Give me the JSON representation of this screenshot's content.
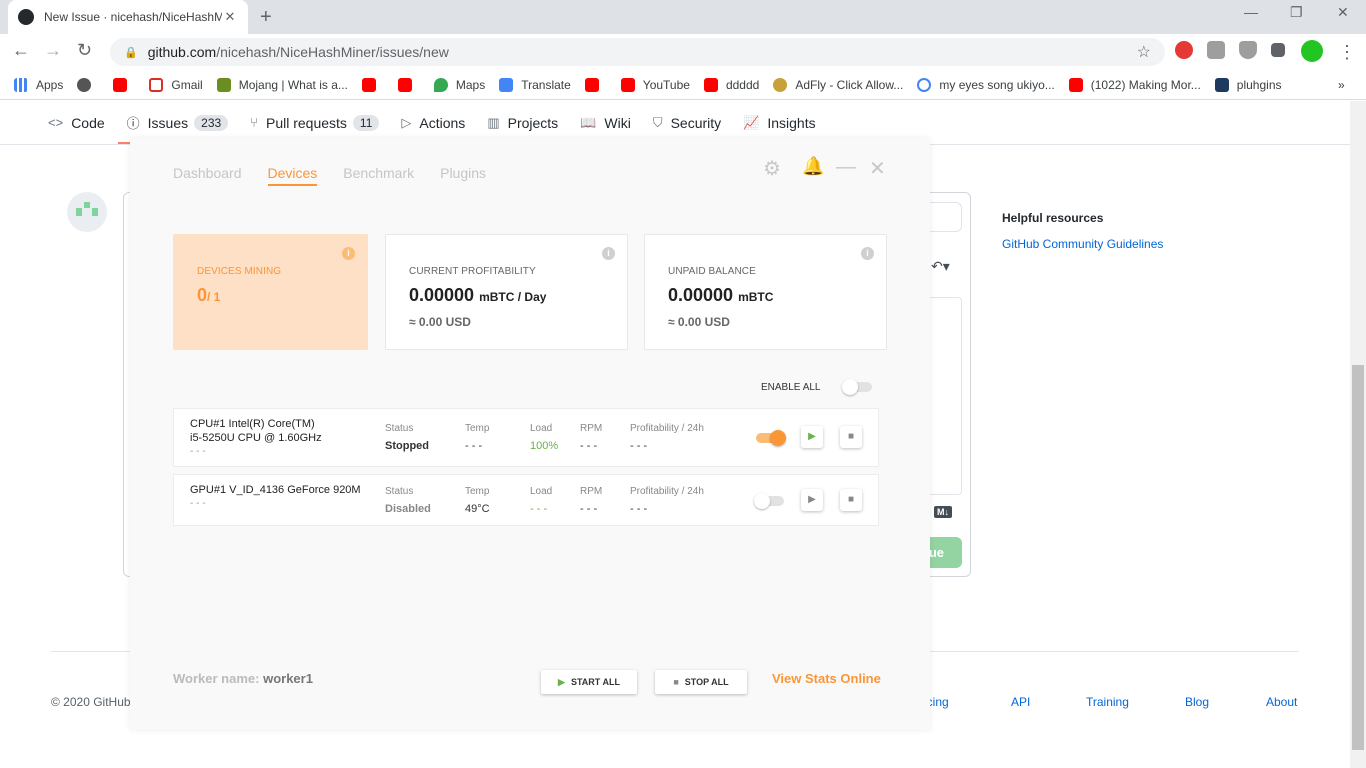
{
  "browser": {
    "tab_title": "New Issue · nicehash/NiceHashM",
    "url_host": "github.com",
    "url_path": "/nicehash/NiceHashMiner/issues/new",
    "bookmarks": [
      "Apps",
      "",
      "",
      "Gmail",
      "Mojang | What is a...",
      "",
      "",
      "Maps",
      "Translate",
      "",
      "YouTube",
      "ddddd",
      "AdFly - Click Allow...",
      "my eyes song ukiyo...",
      "(1022) Making Mor...",
      "pluhgins"
    ]
  },
  "github": {
    "nav": [
      {
        "label": "Code",
        "icon": "code-icon"
      },
      {
        "label": "Issues",
        "count": "233",
        "icon": "issue-icon"
      },
      {
        "label": "Pull requests",
        "count": "11",
        "icon": "pull-request-icon"
      },
      {
        "label": "Actions",
        "icon": "play-circle-icon"
      },
      {
        "label": "Projects",
        "icon": "project-icon"
      },
      {
        "label": "Wiki",
        "icon": "book-icon"
      },
      {
        "label": "Security",
        "icon": "shield-icon"
      },
      {
        "label": "Insights",
        "icon": "graph-icon"
      }
    ],
    "helpful_title": "Helpful resources",
    "guidelines": "GitHub Community Guidelines",
    "submit_partial": "ue",
    "footer_copyright": "© 2020 GitHub",
    "footer_links": [
      "icing",
      "API",
      "Training",
      "Blog",
      "About"
    ]
  },
  "nicehash": {
    "tabs": [
      "Dashboard",
      "Devices",
      "Benchmark",
      "Plugins"
    ],
    "active_tab": "Devices",
    "cards": {
      "devices_mining": {
        "label": "DEVICES MINING",
        "value": "0",
        "total": "/ 1"
      },
      "profitability": {
        "label": "CURRENT PROFITABILITY",
        "value": "0.00000",
        "unit": "mBTC / Day",
        "usd": "≈ 0.00 USD"
      },
      "balance": {
        "label": "UNPAID BALANCE",
        "value": "0.00000",
        "unit": "mBTC",
        "usd": "≈ 0.00 USD"
      }
    },
    "enable_all": "ENABLE ALL",
    "columns": {
      "status": "Status",
      "temp": "Temp",
      "load": "Load",
      "rpm": "RPM",
      "profit": "Profitability / 24h"
    },
    "devices": [
      {
        "name_line1": "CPU#1 Intel(R) Core(TM)",
        "name_line2": "i5-5250U CPU @ 1.60GHz",
        "dash": "- - -",
        "status": "Stopped",
        "temp": "- - -",
        "load": "100%",
        "rpm": "- - -",
        "profit": "- - -",
        "enabled": true
      },
      {
        "name_line1": "GPU#1 V_ID_4136 GeForce 920M",
        "name_line2": "",
        "dash": "- - -",
        "status": "Disabled",
        "temp": "49°C",
        "load": "- - -",
        "rpm": "- - -",
        "profit": "- - -",
        "enabled": false
      }
    ],
    "worker_label": "Worker name:",
    "worker_name": "worker1",
    "start_all": "START ALL",
    "stop_all": "STOP ALL",
    "view_stats": "View Stats Online",
    "accent": "#fb9637"
  }
}
